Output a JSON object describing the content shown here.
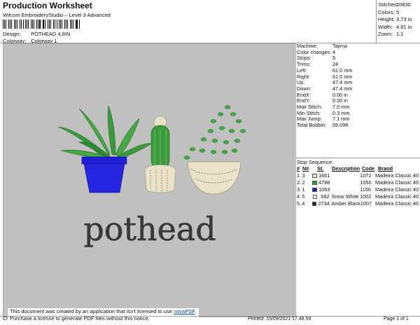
{
  "header": {
    "title": "Production Worksheet",
    "subtitle": "Wilcom EmbroideryStudio – Level 3 Advanced",
    "design_label": "Design:",
    "design_value": "POTHEAD 4,8IN",
    "colorway_label": "Colorway:",
    "colorway_value": "Colorway 1"
  },
  "stats": [
    {
      "label": "Stitches:",
      "value": "10830"
    },
    {
      "label": "Colors:",
      "value": "5"
    },
    {
      "label": "Height:",
      "value": "3.73 in"
    },
    {
      "label": "Width:",
      "value": "4.81 in"
    },
    {
      "label": "Zoom:",
      "value": "1:1"
    }
  ],
  "info": [
    {
      "label": "Machine:",
      "value": "Tajima"
    },
    {
      "label": "Color changes:",
      "value": "4"
    },
    {
      "label": "Stops:",
      "value": "5"
    },
    {
      "label": "Trims:",
      "value": "24"
    },
    {
      "label": "Left:",
      "value": "61.0 mm"
    },
    {
      "label": "Right:",
      "value": "61.0 mm"
    },
    {
      "label": "Up:",
      "value": "47.4 mm"
    },
    {
      "label": "Down:",
      "value": "47.4 mm"
    },
    {
      "label": "EndX:",
      "value": "0.00 in"
    },
    {
      "label": "EndY:",
      "value": "0.00 in"
    },
    {
      "label": "Max Stitch:",
      "value": "7.0 mm"
    },
    {
      "label": "Min Stitch:",
      "value": "0.3 mm"
    },
    {
      "label": "Max Jump:",
      "value": "7.1 mm"
    },
    {
      "label": "Total Bobbin:",
      "value": "59.09ft"
    }
  ],
  "sequence": {
    "title": "Stop Sequence:",
    "headers": {
      "hash": "#",
      "n": "N#",
      "st": "St.",
      "desc": "Description",
      "code": "Code",
      "brand": "Brand"
    },
    "rows": [
      {
        "hash": "1.",
        "n": "3",
        "color": "#e8e2c8",
        "st": "1661",
        "desc": "",
        "code": "1072",
        "brand": "Madeira Classic 40"
      },
      {
        "hash": "2.",
        "n": "2",
        "color": "#2f9a3a",
        "st": "4788",
        "desc": "",
        "code": "1050",
        "brand": "Madeira Classic 40"
      },
      {
        "hash": "3.",
        "n": "1",
        "color": "#1a1ad0",
        "st": "1063",
        "desc": "",
        "code": "1166",
        "brand": "Madeira Classic 40"
      },
      {
        "hash": "4.",
        "n": "5",
        "color": "#f4f4f4",
        "st": "582",
        "desc": "Snow White",
        "code": "1002",
        "brand": "Madeira Classic 40"
      },
      {
        "hash": "5.",
        "n": "4",
        "color": "#222222",
        "st": "2734",
        "desc": "Amber Black",
        "code": "1007",
        "brand": "Madeira Classic 40"
      }
    ]
  },
  "design_text": "pothead",
  "notice": {
    "line1_prefix": "This document was created by an application that isn't licensed to use ",
    "line1_link": "novaPDF",
    "line1_suffix": ".",
    "line2": "Purchase a license to generate PDF files without this notice."
  },
  "footer": {
    "cr": "Cr",
    "printed": "Printed: 15/09/2021 17.48.59",
    "page": "Page 1 of 1"
  }
}
